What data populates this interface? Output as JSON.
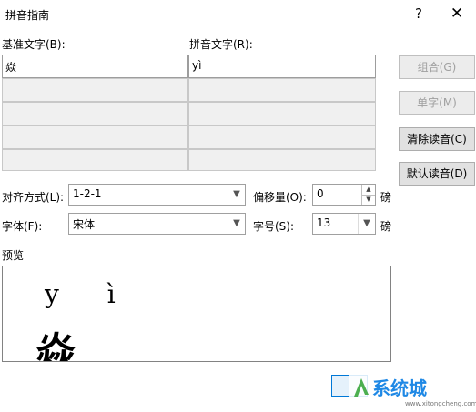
{
  "dialog": {
    "title": "拼音指南",
    "help_label": "?",
    "close_label": "✕"
  },
  "grid": {
    "base_header": "基准文字(B):",
    "ruby_header": "拼音文字(R):",
    "rows": [
      {
        "base": "焱",
        "ruby": "yì"
      },
      {
        "base": "",
        "ruby": ""
      },
      {
        "base": "",
        "ruby": ""
      },
      {
        "base": "",
        "ruby": ""
      },
      {
        "base": "",
        "ruby": ""
      }
    ]
  },
  "buttons": {
    "combine": "组合(G)",
    "single": "单字(M)",
    "clear": "清除读音(C)",
    "default": "默认读音(D)"
  },
  "options": {
    "alignment_label": "对齐方式(L):",
    "alignment_value": "1-2-1",
    "offset_label": "偏移量(O):",
    "offset_value": "0",
    "offset_unit": "磅",
    "font_label": "字体(F):",
    "font_value": "宋体",
    "size_label": "字号(S):",
    "size_value": "13",
    "size_unit": "磅"
  },
  "preview": {
    "label": "预览",
    "pinyin": "y ì",
    "base_char": "焱"
  },
  "watermark": {
    "text": "系统城",
    "url": "www.xitongcheng.com"
  }
}
